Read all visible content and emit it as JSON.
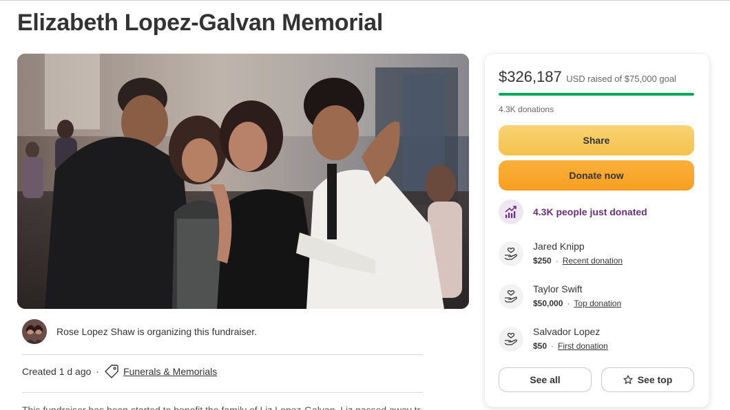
{
  "page": {
    "title": "Elizabeth Lopez-Galvan Memorial"
  },
  "photo": {
    "icon": "fundraiser-photo"
  },
  "organizer": {
    "text": "Rose Lopez Shaw is organizing this fundraiser."
  },
  "meta": {
    "created": "Created 1 d ago",
    "separator": "·",
    "category": "Funerals & Memorials"
  },
  "description": {
    "preview": "This fundraiser has been started to benefit the family of Liz Lopez-Galvan. Liz passed away tragically..."
  },
  "sidebar": {
    "amount_raised": "$326,187",
    "goal_text": "USD raised of $75,000 goal",
    "progress_fraction": 1.0,
    "donations_count": "4.3K donations",
    "share_label": "Share",
    "donate_label": "Donate now",
    "trend_text": "4.3K people just donated",
    "donors": [
      {
        "name": "Jared Knipp",
        "amount": "$250",
        "separator": "·",
        "kind": "Recent donation"
      },
      {
        "name": "Taylor Swift",
        "amount": "$50,000",
        "separator": "·",
        "kind": "Top donation"
      },
      {
        "name": "Salvador Lopez",
        "amount": "$50",
        "separator": "·",
        "kind": "First donation"
      }
    ],
    "see_all_label": "See all",
    "see_top_label": "See top"
  },
  "colors": {
    "progress": "#02a95c",
    "trend_text": "#6b2e7e",
    "share_button": "#f4c14c",
    "donate_button": "#f79f22"
  }
}
